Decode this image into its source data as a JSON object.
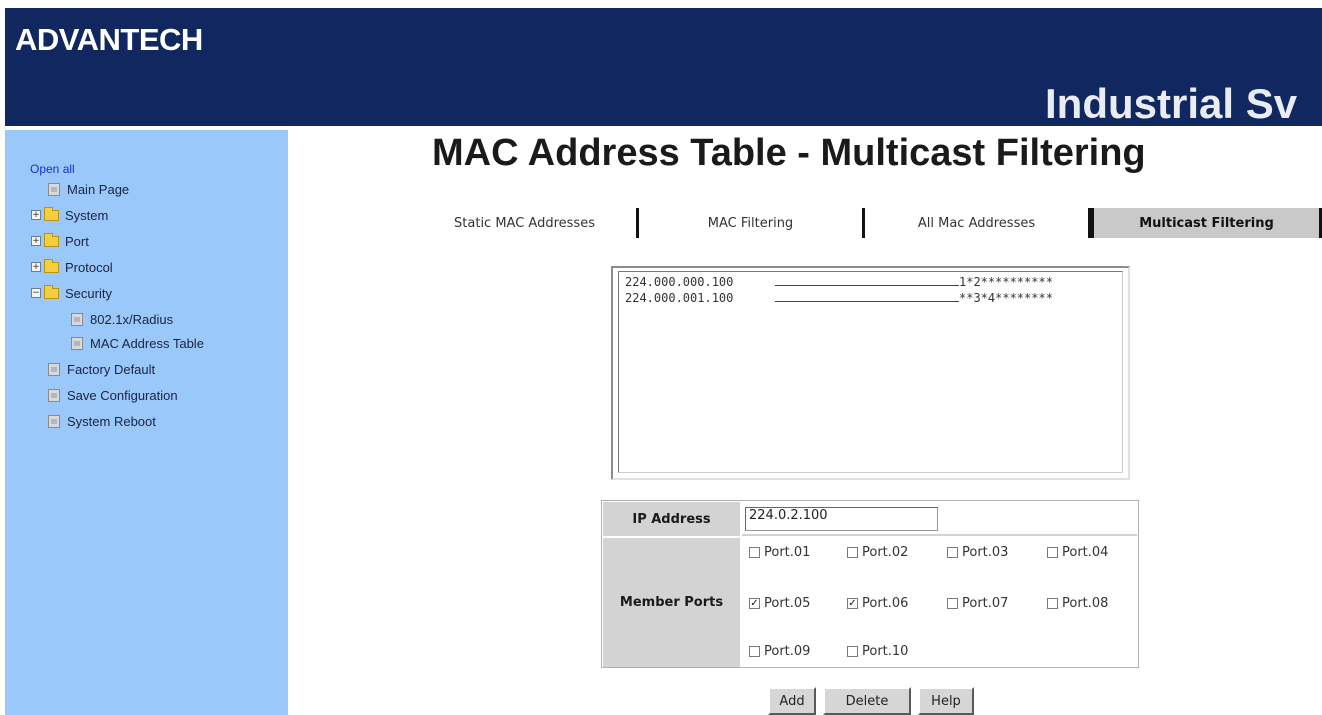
{
  "header": {
    "logo_text": "ADVANTECH",
    "banner_title": "Industrial Sv",
    "colors": {
      "banner_bg": "#11275f",
      "banner_text": "#ffffff"
    }
  },
  "sidebar": {
    "open_all": "Open all",
    "items": [
      {
        "label": "Main Page",
        "icon": "page-icon",
        "expandable": false
      },
      {
        "label": "System",
        "icon": "folder-icon",
        "expandable": true,
        "expander": "+"
      },
      {
        "label": "Port",
        "icon": "folder-icon",
        "expandable": true,
        "expander": "+"
      },
      {
        "label": "Protocol",
        "icon": "folder-icon",
        "expandable": true,
        "expander": "+"
      },
      {
        "label": "Security",
        "icon": "folder-open-icon",
        "expandable": true,
        "expander": "−"
      },
      {
        "label": "802.1x/Radius",
        "icon": "page-icon",
        "expandable": false
      },
      {
        "label": "MAC Address Table",
        "icon": "page-icon",
        "expandable": false
      },
      {
        "label": "Factory Default",
        "icon": "page-icon",
        "expandable": false
      },
      {
        "label": "Save Configuration",
        "icon": "page-icon",
        "expandable": false
      },
      {
        "label": "System Reboot",
        "icon": "page-icon",
        "expandable": false
      }
    ],
    "colors": {
      "background": "#9ac8fb",
      "link": "#1a2dd6"
    }
  },
  "main": {
    "title": "MAC Address Table - Multicast Filtering",
    "tabs": [
      {
        "label": "Static MAC Addresses",
        "active": false
      },
      {
        "label": "MAC Filtering",
        "active": false
      },
      {
        "label": "All Mac Addresses",
        "active": false
      },
      {
        "label": "Multicast Filtering",
        "active": true
      }
    ],
    "multicast_list": [
      {
        "ip": "224.000.000.100",
        "ports": "1*2**********"
      },
      {
        "ip": "224.000.001.100",
        "ports": "**3*4********"
      }
    ],
    "form": {
      "ip_label": "IP Address",
      "ip_value": "224.0.2.100",
      "member_ports_label": "Member Ports",
      "ports": [
        {
          "label": "Port.01",
          "checked": false
        },
        {
          "label": "Port.02",
          "checked": false
        },
        {
          "label": "Port.03",
          "checked": false
        },
        {
          "label": "Port.04",
          "checked": false
        },
        {
          "label": "Port.05",
          "checked": true
        },
        {
          "label": "Port.06",
          "checked": true
        },
        {
          "label": "Port.07",
          "checked": false
        },
        {
          "label": "Port.08",
          "checked": false
        },
        {
          "label": "Port.09",
          "checked": false
        },
        {
          "label": "Port.10",
          "checked": false
        }
      ]
    },
    "buttons": {
      "add": "Add",
      "delete": "Delete",
      "help": "Help"
    },
    "check_mark": "✓"
  }
}
